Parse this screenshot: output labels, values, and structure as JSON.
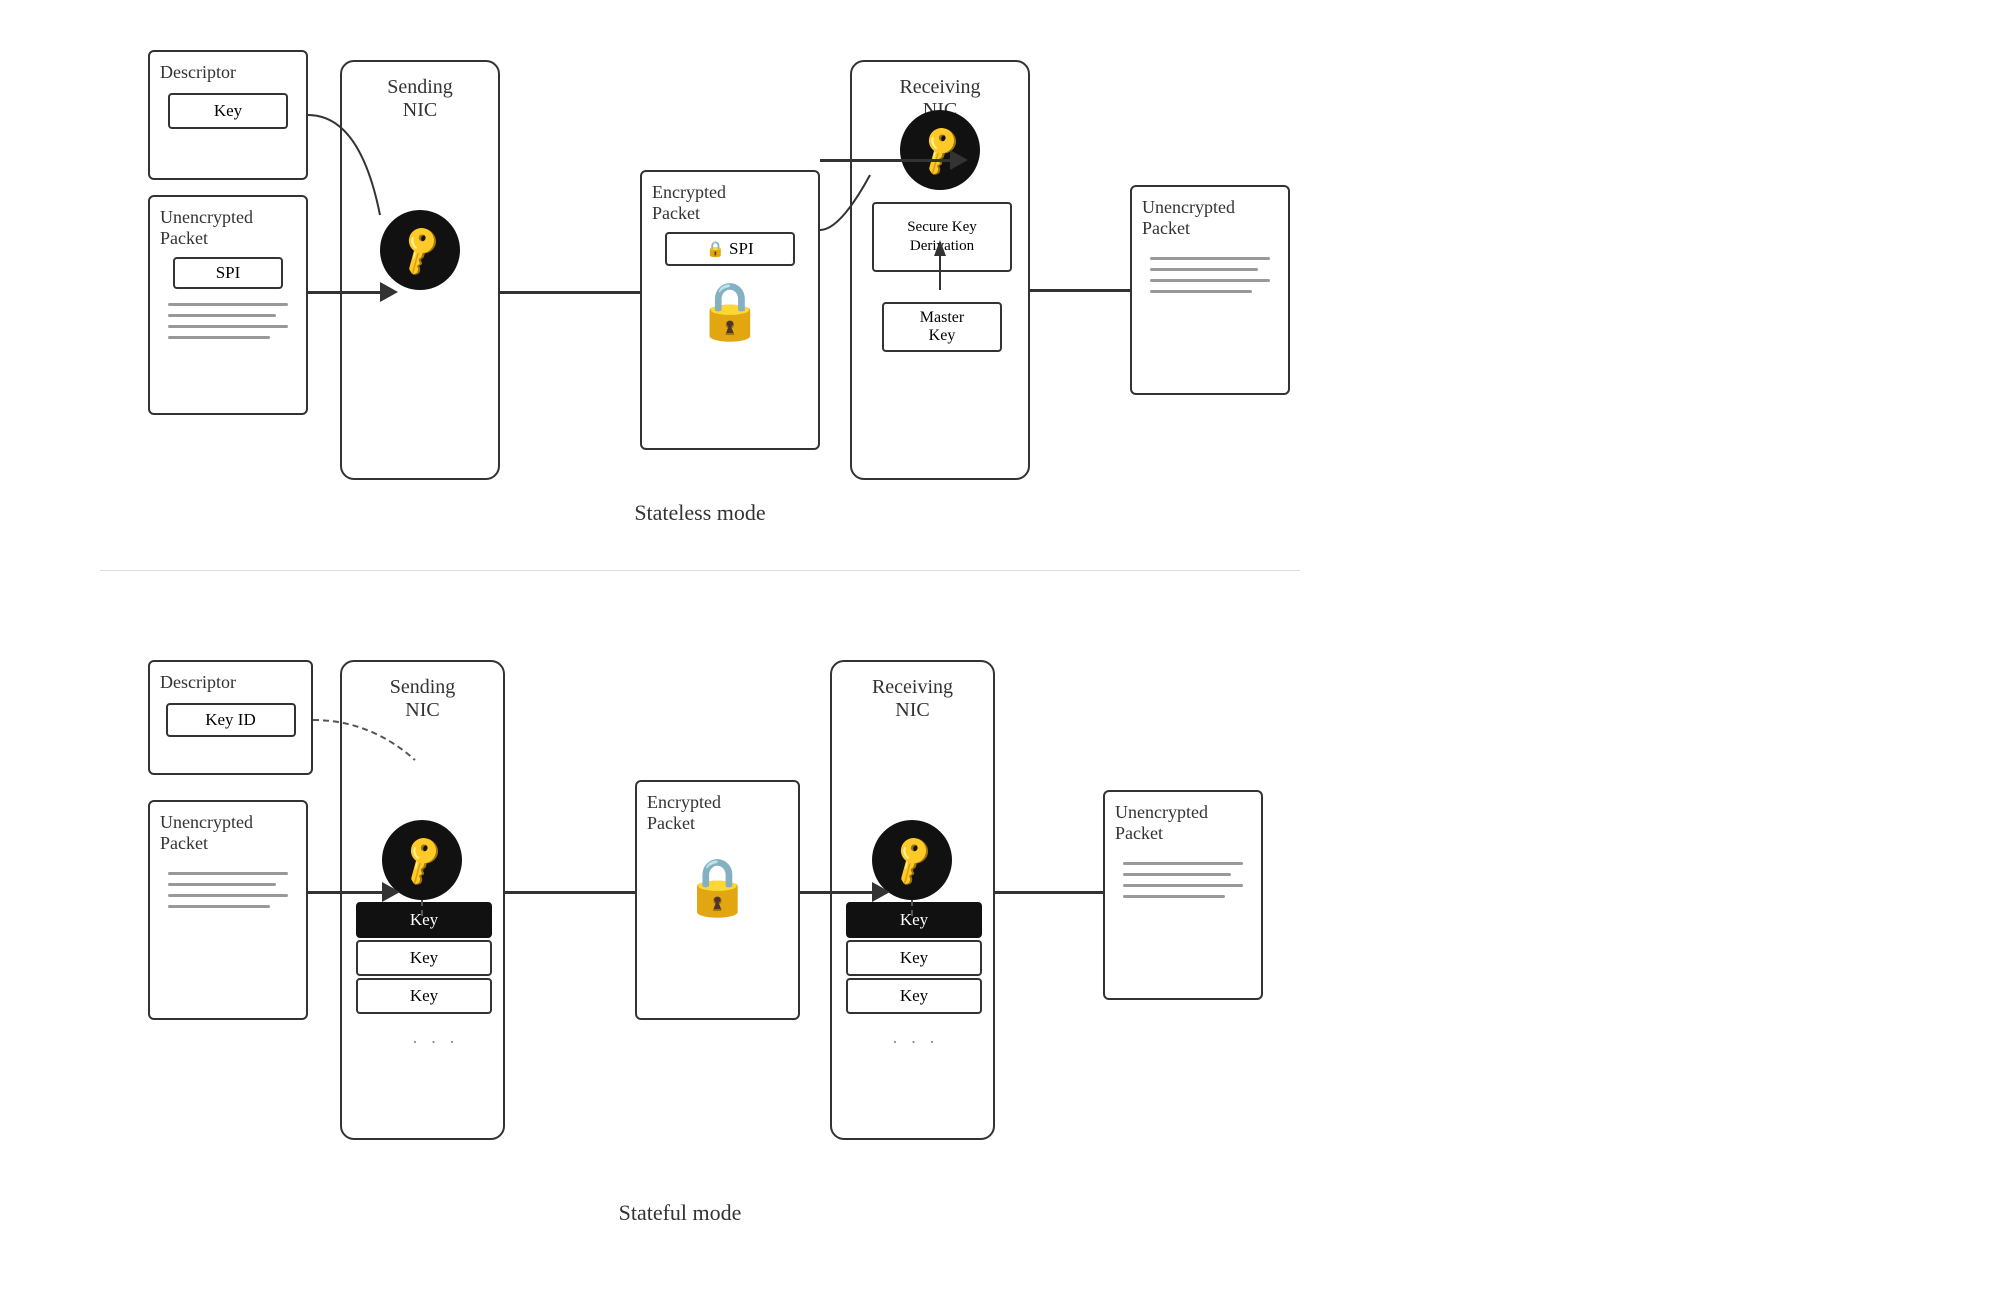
{
  "top": {
    "caption": "Stateless mode",
    "descriptor": {
      "title": "Descriptor",
      "key_label": "Key"
    },
    "unencrypted_packet_left": {
      "title1": "Unencrypted",
      "title2": "Packet",
      "spi_label": "SPI"
    },
    "sending_nic": {
      "title1": "Sending",
      "title2": "NIC"
    },
    "encrypted_packet": {
      "title1": "Encrypted",
      "title2": "Packet",
      "spi_label": "SPI"
    },
    "receiving_nic": {
      "title1": "Receiving",
      "title2": "NIC",
      "secure_key_label": "Secure Key\nDerivation",
      "master_key_label": "Master\nKey"
    },
    "unencrypted_packet_right": {
      "title1": "Unencrypted",
      "title2": "Packet"
    }
  },
  "bottom": {
    "caption": "Stateful mode",
    "descriptor": {
      "title": "Descriptor",
      "key_id_label": "Key ID"
    },
    "unencrypted_packet_left": {
      "title1": "Unencrypted",
      "title2": "Packet"
    },
    "sending_nic": {
      "title1": "Sending",
      "title2": "NIC",
      "key1": "Key",
      "key2": "Key",
      "key3": "Key"
    },
    "encrypted_packet": {
      "title1": "Encrypted",
      "title2": "Packet"
    },
    "receiving_nic": {
      "title1": "Receiving",
      "title2": "NIC",
      "key1": "Key",
      "key2": "Key",
      "key3": "Key"
    },
    "unencrypted_packet_right": {
      "title1": "Unencrypted",
      "title2": "Packet"
    }
  }
}
